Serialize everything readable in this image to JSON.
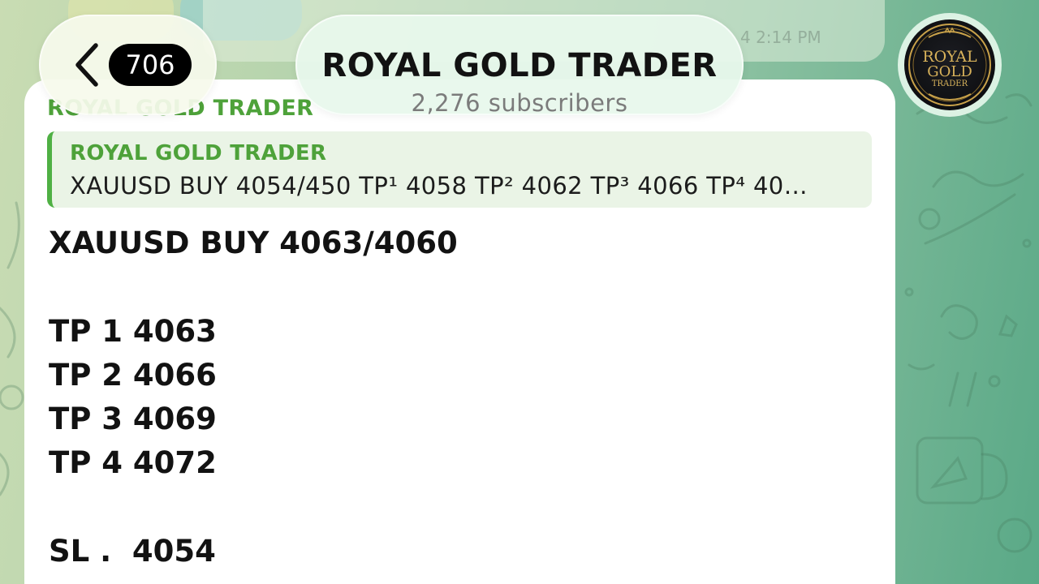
{
  "header": {
    "unread_count": "706",
    "channel_title": "ROYAL GOLD TRADER",
    "subscribers": "2,276 subscribers"
  },
  "avatar": {
    "logo_line1": "ROYAL",
    "logo_line2": "GOLD",
    "logo_line3": "TRADER"
  },
  "previous_message": {
    "time": "4 2:14 PM"
  },
  "message": {
    "sender_name": "ROYAL GOLD TRADER",
    "reply": {
      "author": "ROYAL GOLD TRADER",
      "text": "XAUUSD BUY 4054/450 TP¹ 4058 TP² 4062 TP³ 4066 TP⁴ 40…"
    },
    "lines": {
      "signal": "XAUUSD BUY 4063/4060",
      "tp1": "TP 1 4063",
      "tp2": "TP 2 4066",
      "tp3": "TP 3 4069",
      "tp4": "TP 4 4072",
      "sl": "SL .  4054"
    }
  },
  "colors": {
    "accent_green": "#4ea23a",
    "reply_bar": "#4fb044",
    "badge_bg": "#000000"
  },
  "icons": {
    "back": "chevron-left-icon"
  }
}
